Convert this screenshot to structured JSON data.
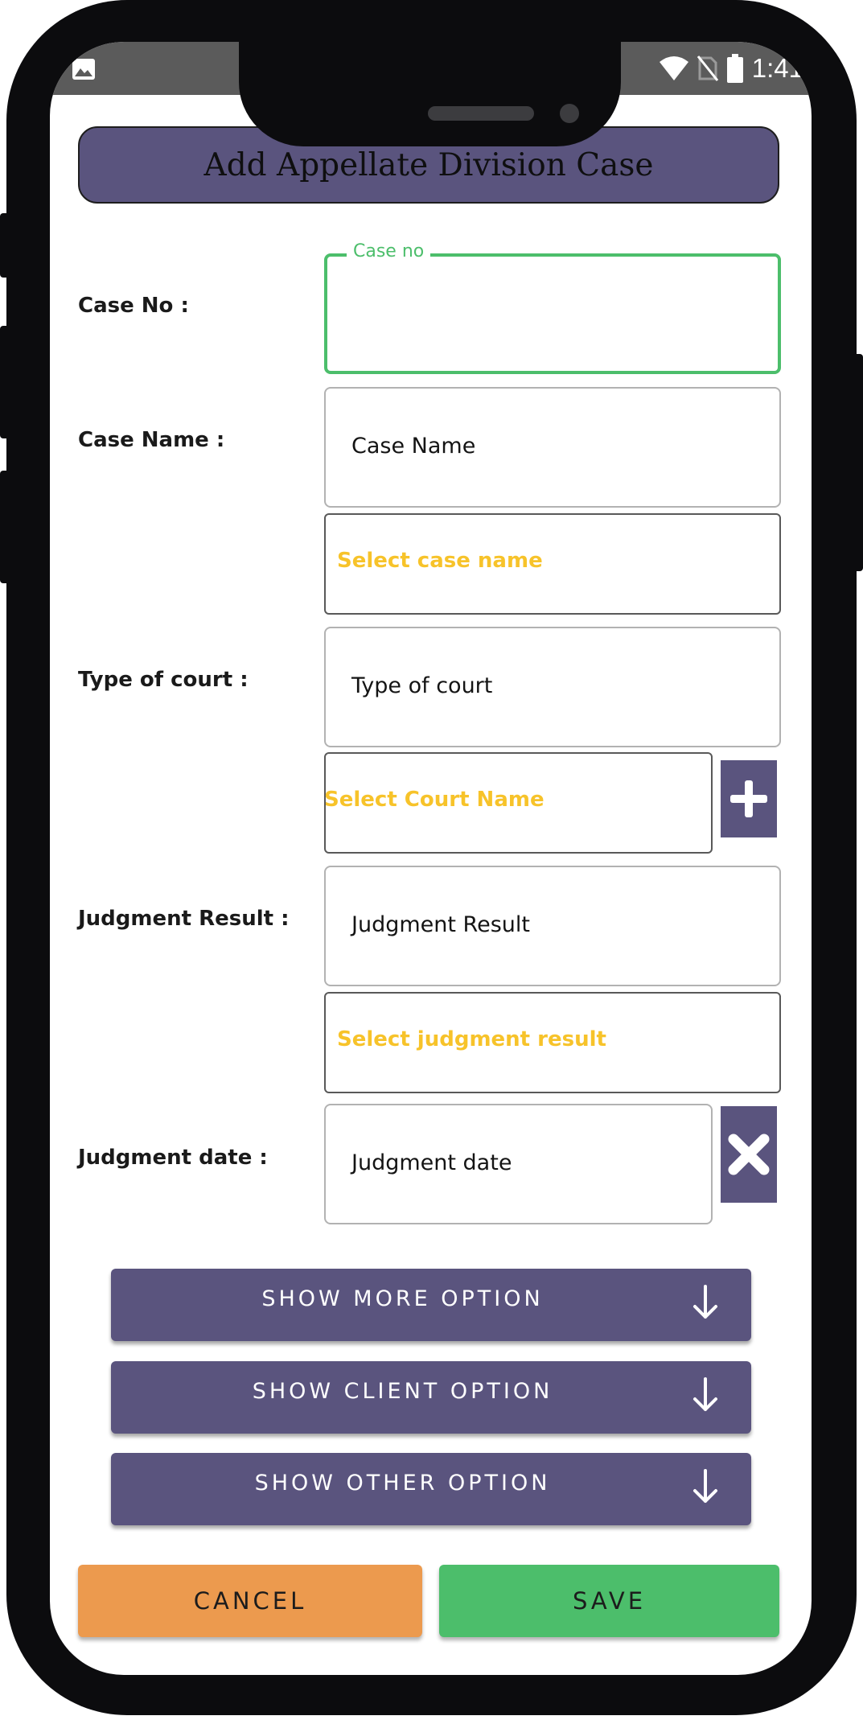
{
  "status_bar": {
    "time": "1:41",
    "icons": [
      "gallery-icon",
      "wifi-icon",
      "no-sim-icon",
      "battery-icon"
    ]
  },
  "page": {
    "title": "Add Appellate Division Case"
  },
  "form": {
    "case_no": {
      "label": "Case No :",
      "floating_label": "Case no",
      "value": ""
    },
    "case_name": {
      "label": "Case Name :",
      "placeholder": "Case Name",
      "select_hint": "Select case name"
    },
    "type_of_court": {
      "label": "Type of court :",
      "placeholder": "Type of court",
      "select_hint": "Select Court Name"
    },
    "judgment_result": {
      "label": "Judgment Result :",
      "placeholder": "Judgment Result",
      "select_hint": "Select judgment result"
    },
    "judgment_date": {
      "label": "Judgment date :",
      "placeholder": "Judgment date"
    }
  },
  "options": [
    {
      "label": "SHOW MORE OPTION"
    },
    {
      "label": "SHOW CLIENT OPTION"
    },
    {
      "label": "SHOW OTHER OPTION"
    }
  ],
  "actions": {
    "cancel": "CANCEL",
    "save": "SAVE"
  },
  "colors": {
    "accent": "#5a547e",
    "focus_green": "#4cbe6b",
    "hint_yellow": "#f7c32a",
    "cancel_orange": "#ec9a4e",
    "save_green": "#4cbe6b"
  }
}
